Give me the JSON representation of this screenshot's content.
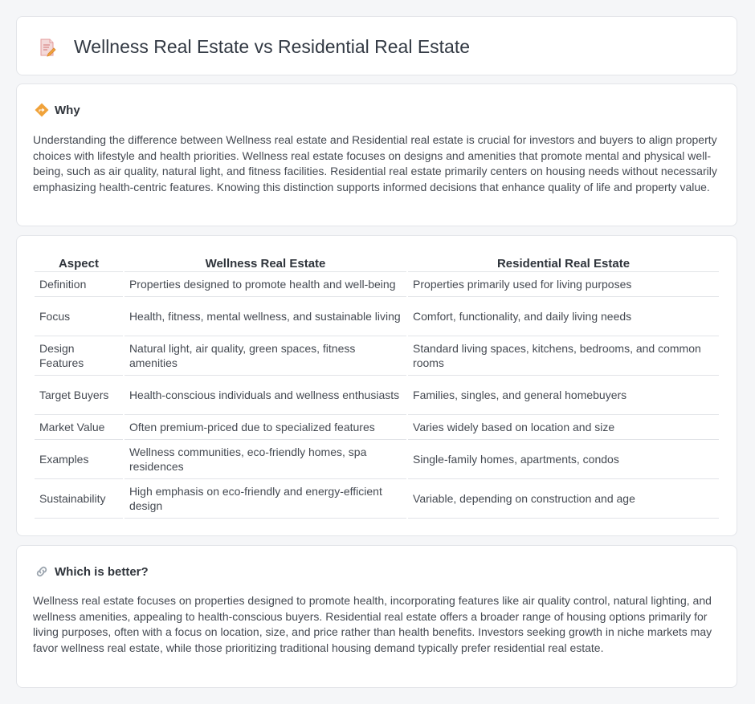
{
  "page": {
    "title": "Wellness Real Estate vs Residential Real Estate",
    "icon": "document-pencil-icon"
  },
  "why": {
    "icon": "diamond-signpost-icon",
    "heading": "Why",
    "text": "Understanding the difference between Wellness real estate and Residential real estate is crucial for investors and buyers to align property choices with lifestyle and health priorities. Wellness real estate focuses on designs and amenities that promote mental and physical well-being, such as air quality, natural light, and fitness facilities. Residential real estate primarily centers on housing needs without necessarily emphasizing health-centric features. Knowing this distinction supports informed decisions that enhance quality of life and property value."
  },
  "comparison": {
    "headers": [
      "Aspect",
      "Wellness Real Estate",
      "Residential Real Estate"
    ],
    "rows": [
      [
        "Definition",
        "Properties designed to promote health and well-being",
        "Properties primarily used for living purposes"
      ],
      [
        "Focus",
        "Health, fitness, mental wellness, and sustainable living",
        "Comfort, functionality, and daily living needs"
      ],
      [
        "Design Features",
        "Natural light, air quality, green spaces, fitness amenities",
        "Standard living spaces, kitchens, bedrooms, and common rooms"
      ],
      [
        "Target Buyers",
        "Health-conscious individuals and wellness enthusiasts",
        "Families, singles, and general homebuyers"
      ],
      [
        "Market Value",
        "Often premium-priced due to specialized features",
        "Varies widely based on location and size"
      ],
      [
        "Examples",
        "Wellness communities, eco-friendly homes, spa residences",
        "Single-family homes, apartments, condos"
      ],
      [
        "Sustainability",
        "High emphasis on eco-friendly and energy-efficient design",
        "Variable, depending on construction and age"
      ]
    ]
  },
  "which": {
    "icon": "link-icon",
    "heading": "Which is better?",
    "text": "Wellness real estate focuses on properties designed to promote health, incorporating features like air quality control, natural lighting, and wellness amenities, appealing to health-conscious buyers. Residential real estate offers a broader range of housing options primarily for living purposes, often with a focus on location, size, and price rather than health benefits. Investors seeking growth in niche markets may favor wellness real estate, while those prioritizing traditional housing demand typically prefer residential real estate."
  },
  "colors": {
    "background": "#f5f6f8",
    "card": "#ffffff",
    "border": "#e3e5e9",
    "accent_orange": "#f0a23a",
    "icon_pink": "#e57373"
  }
}
